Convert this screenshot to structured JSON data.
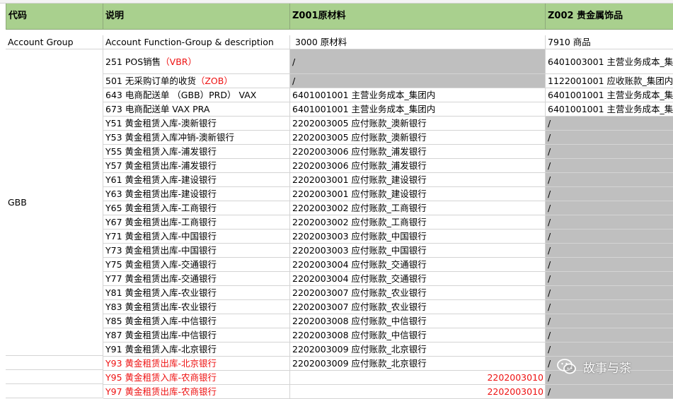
{
  "header": {
    "col_a": "代码",
    "col_b": "说明",
    "col_c": "Z001原材料",
    "col_d": "Z002 贵金属饰品"
  },
  "account_group_row": {
    "a": "Account Group",
    "b": "Account Function-Group & description",
    "c": "3000 原材料",
    "d": "7910 商品"
  },
  "group_code": "GBB",
  "rows": [
    {
      "b": "251 POS销售",
      "tag": "（VBR）",
      "c": "/",
      "d": "6401003001 主营业务成本_集"
    },
    {
      "b": "501 无采购订单的收货",
      "tag": "（ZOB）",
      "c": "/",
      "d": "1122001001 应收账款_集团内"
    },
    {
      "b": "643 电商配送单 （GBB）PRD） VAX",
      "tag": "",
      "c": "6401001001 主营业务成本_集团内",
      "d": "6401001001 主营业务成本_集"
    },
    {
      "b": "673 电商配送单 VAX PRA",
      "tag": "",
      "c": "6401001001 主营业务成本_集团内",
      "d": "6401001001 主营业务成本_集"
    },
    {
      "b": "Y51 黄金租赁入库-澳新银行",
      "tag": "",
      "c": "2202003005 应付账款_澳新银行",
      "d": "/"
    },
    {
      "b": "Y53 黄金租赁入库冲销-澳新银行",
      "tag": "",
      "c": "2202003005 应付账款_澳新银行",
      "d": "/"
    },
    {
      "b": "Y55 黄金租赁入库-浦发银行",
      "tag": "",
      "c": "2202003006 应付账款_浦发银行",
      "d": "/"
    },
    {
      "b": "Y57 黄金租赁出库-浦发银行",
      "tag": "",
      "c": "2202003006 应付账款_浦发银行",
      "d": "/"
    },
    {
      "b": "Y61 黄金租赁入库-建设银行",
      "tag": "",
      "c": "2202003001 应付账款_建设银行",
      "d": "/"
    },
    {
      "b": "Y63 黄金租赁出库-建设银行",
      "tag": "",
      "c": "2202003001 应付账款_建设银行",
      "d": "/"
    },
    {
      "b": "Y65 黄金租赁入库-工商银行",
      "tag": "",
      "c": "2202003002 应付账款_工商银行",
      "d": "/"
    },
    {
      "b": "Y67 黄金租赁出库-工商银行",
      "tag": "",
      "c": "2202003002 应付账款_工商银行",
      "d": "/"
    },
    {
      "b": "Y71 黄金租赁入库-中国银行",
      "tag": "",
      "c": "2202003003 应付账款_中国银行",
      "d": "/"
    },
    {
      "b": "Y73 黄金租赁出库-中国银行",
      "tag": "",
      "c": "2202003003 应付账款_中国银行",
      "d": "/"
    },
    {
      "b": "Y75 黄金租赁入库-交通银行",
      "tag": "",
      "c": "2202003004 应付账款_交通银行",
      "d": "/"
    },
    {
      "b": "Y77 黄金租赁出库-交通银行",
      "tag": "",
      "c": "2202003004 应付账款_交通银行",
      "d": "/"
    },
    {
      "b": "Y81 黄金租赁入库-农业银行",
      "tag": "",
      "c": "2202003007 应付账款_农业银行",
      "d": "/"
    },
    {
      "b": "Y83 黄金租赁出库-农业银行",
      "tag": "",
      "c": "2202003007 应付账款_农业银行",
      "d": "/"
    },
    {
      "b": "Y85 黄金租赁入库-中信银行",
      "tag": "",
      "c": "2202003008 应付账款_中信银行",
      "d": "/"
    },
    {
      "b": "Y87 黄金租赁出库-中信银行",
      "tag": "",
      "c": "2202003008 应付账款_中信银行",
      "d": "/"
    },
    {
      "b": "Y91 黄金租赁入库-北京银行",
      "tag": "",
      "c": "2202003009 应付账款_北京银行",
      "d": "/"
    },
    {
      "b": "Y93 黄金租赁出库-北京银行",
      "tag": "",
      "c": "2202003009 应付账款_北京银行",
      "d": "/"
    },
    {
      "b": "Y95 黄金租赁入库-农商银行",
      "tag": "",
      "c": "2202003010",
      "d": "/"
    },
    {
      "b": "Y97 黄金租赁出库-农商银行",
      "tag": "",
      "c": "2202003010",
      "d": "/"
    }
  ],
  "watermark": {
    "text": "故事与茶",
    "icon": "wechat-icon"
  },
  "colors": {
    "header_bg": "#a9d08e",
    "gray_fill": "#bfbfbf",
    "red_text": "#ee1111",
    "grid": "#d4d4d4"
  }
}
